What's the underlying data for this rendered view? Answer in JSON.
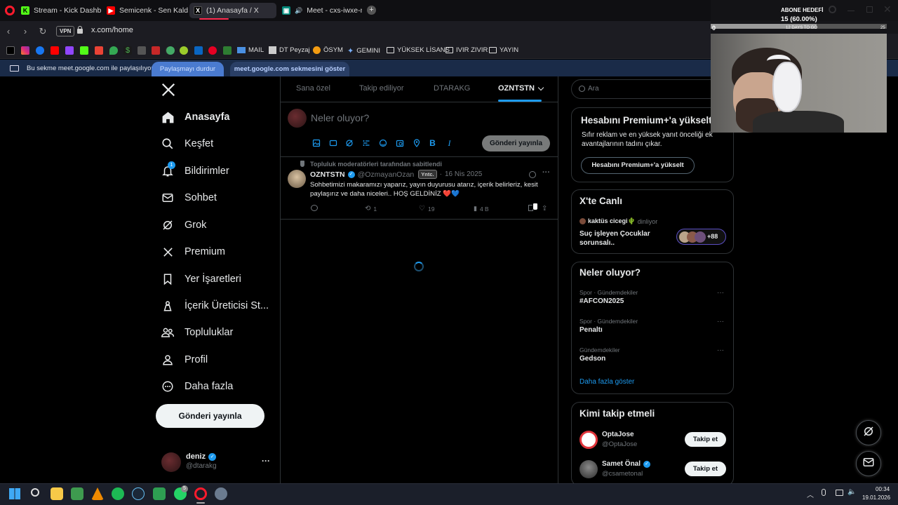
{
  "browser": {
    "tabs": [
      {
        "title": "Stream - Kick Dashboard",
        "icon": "kick-icon",
        "color": "#53fc18"
      },
      {
        "title": "Semicenk - Sen Kaldın (p",
        "icon": "youtube-icon",
        "color": "#ff0000"
      },
      {
        "title": "(1) Anasayfa / X",
        "icon": "x-icon",
        "color": "#000000"
      },
      {
        "title": "Meet - cxs-iwxe-muw",
        "icon": "meet-icon",
        "color": "#00897b"
      }
    ],
    "vpn_label": "VPN",
    "url": "x.com/home",
    "bookmarks": {
      "mail": "MAIL",
      "dt_peyzaj": "DT Peyzaj",
      "osym": "ÖSYM",
      "gemini": "GEMINI",
      "yuksek_lisans": "YÜKSEK LİSANS",
      "ivir_zivir": "IVIR ZIVIR",
      "yayin": "YAYIN"
    },
    "share_bar": {
      "text": "Bu sekme meet.google.com ile paylaşılıyor",
      "stop_label": "Paylaşmayı durdur",
      "show_label": "meet.google.com sekmesini göster"
    }
  },
  "overlay": {
    "sub_goal_title": "ABONE HEDEFİ",
    "sub_goal_value": "15 (60.00%)",
    "days_to_go": "12 DAYS TO GO",
    "counter_left": "0",
    "counter_right": "25"
  },
  "nav": {
    "items": [
      {
        "label": "Anasayfa",
        "icon": "home-icon",
        "bold": true
      },
      {
        "label": "Keşfet",
        "icon": "search-icon"
      },
      {
        "label": "Bildirimler",
        "icon": "bell-icon",
        "badge": "1"
      },
      {
        "label": "Sohbet",
        "icon": "mail-icon"
      },
      {
        "label": "Grok",
        "icon": "grok-icon"
      },
      {
        "label": "Premium",
        "icon": "x-icon"
      },
      {
        "label": "Yer İşaretleri",
        "icon": "bookmark-icon"
      },
      {
        "label": "İçerik Üreticisi St...",
        "icon": "creator-icon"
      },
      {
        "label": "Topluluklar",
        "icon": "communities-icon"
      },
      {
        "label": "Profil",
        "icon": "profile-icon"
      },
      {
        "label": "Daha fazla",
        "icon": "more-circle-icon"
      }
    ],
    "post_button": "Gönderi yayınla",
    "account": {
      "name": "deniz",
      "handle": "@dtarakg",
      "more": "···"
    }
  },
  "feed": {
    "tabs": [
      "Sana özel",
      "Takip ediliyor",
      "DTARAKG",
      "OZNTSTN"
    ],
    "active_tab": "OZNTSTN",
    "composer_placeholder": "Neler oluyor?",
    "composer_button": "Gönderi yayınla",
    "pinned_post": {
      "pinned_label": "Topluluk moderatörleri tarafından sabitlendi",
      "author": "OZNTSTN",
      "handle": "@OzmayanOzan",
      "role_badge": "Yntc.",
      "separator": "·",
      "date": "16 Nis 2025",
      "text": "Sohbetimizi makaramızı yaparız, yayın duyurusu atarız, içerik belirleriz, kesit paylaşırız ve daha niceleri.. HOŞ GELDİNİZ ❤️💙",
      "retweets": "1",
      "likes": "19",
      "views": "4 B"
    }
  },
  "sidebar": {
    "search_placeholder": "Ara",
    "premium": {
      "title": "Hesabını Premium+'a yükselt",
      "desc": "Sıfır reklam ve en yüksek yanıt önceliği ek avantajlarının tadını çıkar.",
      "button": "Hesabını Premium+'a yükselt"
    },
    "live": {
      "title": "X'te Canlı",
      "host": "kaktüs cicegi🌵",
      "status": "dinliyor",
      "space_title": "Suç işleyen Çocuklar sorunsalı..",
      "listeners": "+88"
    },
    "trends": {
      "title": "Neler oluyor?",
      "items": [
        {
          "meta": "Spor · Gündemdekiler",
          "name": "#AFCON2025"
        },
        {
          "meta": "Spor · Gündemdekiler",
          "name": "Penaltı"
        },
        {
          "meta": "Gündemdekiler",
          "name": "Gedson"
        }
      ],
      "more_link": "Daha fazla göster"
    },
    "who_to_follow": {
      "title": "Kimi takip etmeli",
      "users": [
        {
          "name": "OptaJose",
          "handle": "@OptaJose",
          "button": "Takip et"
        },
        {
          "name": "Samet Önal",
          "handle": "@csametonal",
          "button": "Takip et"
        }
      ]
    }
  },
  "taskbar": {
    "time": "00:34",
    "date": "19.01.2026",
    "whatsapp_badge": "5"
  },
  "colors": {
    "accent": "#1d9bf0",
    "verified": "#1d9bf0",
    "background": "#000000",
    "border": "#2f3336"
  }
}
